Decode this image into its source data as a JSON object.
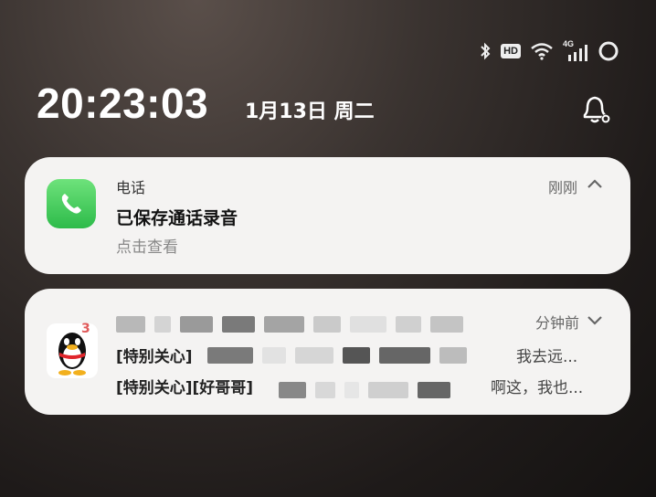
{
  "status_bar": {
    "icons": [
      "bluetooth-icon",
      "hd-icon",
      "wifi-icon",
      "4g-signal-icon",
      "battery-ring-icon"
    ],
    "hd_label": "HD",
    "network_label": "4G"
  },
  "lockscreen": {
    "time": "20:23:03",
    "date": "1月13日 周二"
  },
  "notifications": [
    {
      "app": "电话",
      "title": "已保存通话录音",
      "subtitle": "点击查看",
      "time": "刚刚",
      "expanded": true
    },
    {
      "app": "QQ",
      "badge": "3",
      "time": "分钟前",
      "line1_prefix": "[特别关心]",
      "line1_suffix": "我去远...",
      "line2_prefix": "[特别关心][好哥哥]",
      "line2_suffix": "啊这，我也...",
      "expanded": false
    }
  ],
  "colors": {
    "card_bg": "#f4f3f2",
    "phone_green": "#34c759",
    "badge_red": "#e05a5a"
  }
}
